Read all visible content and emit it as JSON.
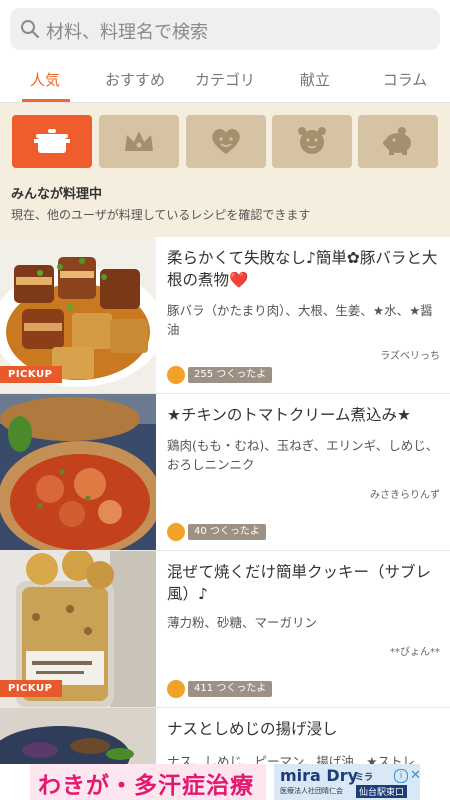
{
  "search": {
    "placeholder": "材料、料理名で検索"
  },
  "tabs": [
    {
      "label": "人気",
      "active": true
    },
    {
      "label": "おすすめ"
    },
    {
      "label": "カテゴリ"
    },
    {
      "label": "献立"
    },
    {
      "label": "コラム"
    }
  ],
  "cooking_now": {
    "categories": [
      {
        "icon": "pot-icon",
        "active": true
      },
      {
        "icon": "crown-icon"
      },
      {
        "icon": "heart-icon"
      },
      {
        "icon": "alarm-clock-icon"
      },
      {
        "icon": "piggy-bank-icon"
      }
    ],
    "title": "みんなが料理中",
    "description": "現在、他のユーザが料理しているレシピを確認できます"
  },
  "recipes": [
    {
      "title": "柔らかくて失敗なし♪簡単✿豚バラと大根の煮物❤️",
      "ingredients": "豚バラ（かたまり肉）、大根、生姜、★水、★醤油",
      "author": "ラズベリっち",
      "tsukurepo": "255 つくったよ",
      "pickup": "PICKUP"
    },
    {
      "title": "★チキンのトマトクリーム煮込み★",
      "ingredients": "鶏肉(もも・むね)、玉ねぎ、エリンギ、しめじ、おろしニンニク",
      "author": "みさきらりんず",
      "tsukurepo": "40 つくったよ"
    },
    {
      "title": "混ぜて焼くだけ簡単クッキー（サブレ風）♪",
      "ingredients": "薄力粉、砂糖、マーガリン",
      "author": "**ぴょん**",
      "tsukurepo": "411 つくったよ",
      "pickup": "PICKUP"
    },
    {
      "title": "ナスとしめじの揚げ浸し",
      "ingredients": "ナス、しめじ、ピーマン、揚げ油、★ストレ"
    }
  ],
  "ad": {
    "headline": "わきが・多汗症治療",
    "brand": "mira Dry",
    "brand_sub": "ミラ",
    "sponsor": "医療法人社団晴仁会",
    "station": "仙台駅東口",
    "info": "i",
    "close": "✕"
  },
  "colors": {
    "accent": "#ee6a2a",
    "category_bg": "#d5c3a3",
    "panel_bg": "#f5eedf"
  }
}
